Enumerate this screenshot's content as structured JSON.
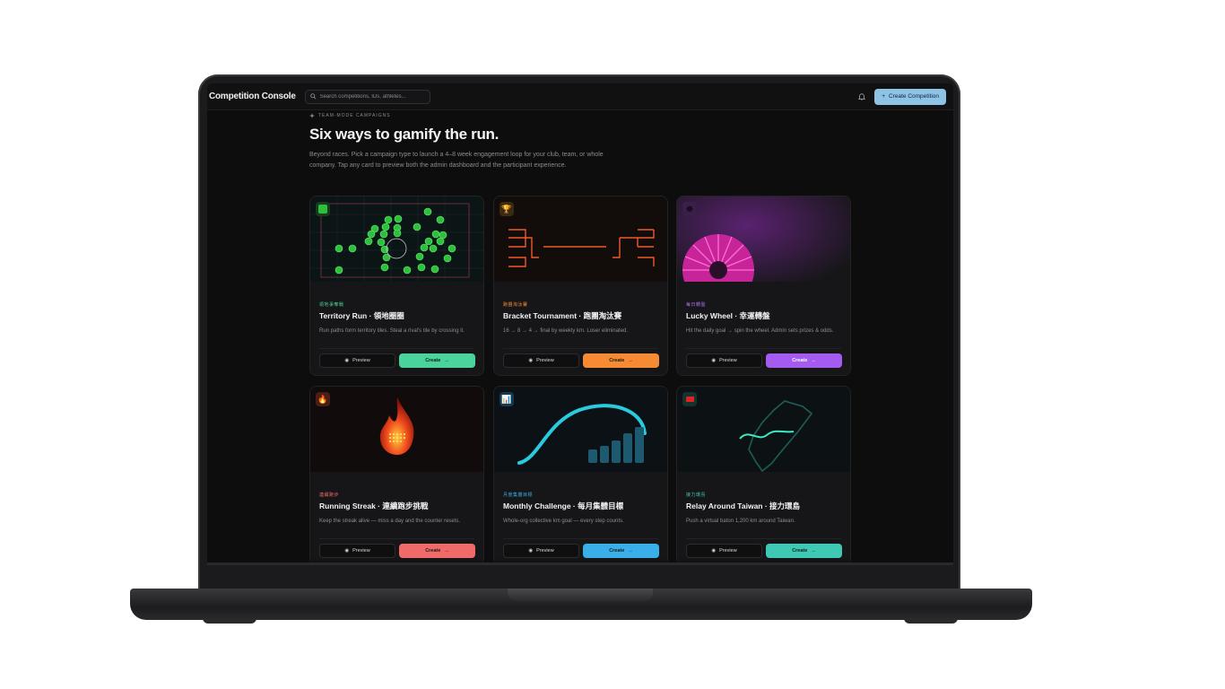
{
  "header": {
    "app_title": "Competition Console",
    "search_placeholder": "Search competitions, IDs, athletes...",
    "create_button": "Create Competition"
  },
  "intro": {
    "eyebrow": "TEAM-MODE CAMPAIGNS",
    "title": "Six ways to gamify the run.",
    "description": "Beyond races. Pick a campaign type to launch a 4–8 week engagement loop for your club, team, or whole company. Tap any card to preview both the admin dashboard and the participant experience."
  },
  "cards": [
    {
      "tag": "領地爭奪戰",
      "name": "Territory Run · 領地圈圈",
      "desc": "Run paths form territory tiles. Steal a rival's tile by crossing it.",
      "preview": "Preview",
      "create": "Create",
      "accent": "#4ad39b",
      "tag_color": "#4ad39b",
      "badge_icon": "grid-icon"
    },
    {
      "tag": "跑團淘汰賽",
      "name": "Bracket Tournament · 跑團淘汰賽",
      "desc": "16 → 8 → 4 → final by weekly km. Loser eliminated.",
      "preview": "Preview",
      "create": "Create",
      "accent": "#f68b33",
      "tag_color": "#f68b33",
      "badge_icon": "trophy-icon"
    },
    {
      "tag": "每日轉盤",
      "name": "Lucky Wheel · 幸運轉盤",
      "desc": "Hit the daily goal → spin the wheel. Admin sets prizes & odds.",
      "preview": "Preview",
      "create": "Create",
      "accent": "#a35bf0",
      "tag_color": "#b06ff2",
      "badge_icon": "wheel-icon"
    },
    {
      "tag": "連續跑步",
      "name": "Running Streak · 連續跑步挑戰",
      "desc": "Keep the streak alive — miss a day and the counter resets.",
      "preview": "Preview",
      "create": "Create",
      "accent": "#f06a6a",
      "tag_color": "#f06a6a",
      "badge_icon": "fire-icon"
    },
    {
      "tag": "月度集體目標",
      "name": "Monthly Challenge · 每月集體目標",
      "desc": "Whole-org collective km goal — every step counts.",
      "preview": "Preview",
      "create": "Create",
      "accent": "#3aaee8",
      "tag_color": "#3aaee8",
      "badge_icon": "chart-icon"
    },
    {
      "tag": "接力環島",
      "name": "Relay Around Taiwan · 接力環島",
      "desc": "Push a virtual baton 1,200 km around Taiwan.",
      "preview": "Preview",
      "create": "Create",
      "accent": "#3ec9b4",
      "tag_color": "#3ec9b4",
      "badge_icon": "taiwan-flag-icon"
    }
  ]
}
